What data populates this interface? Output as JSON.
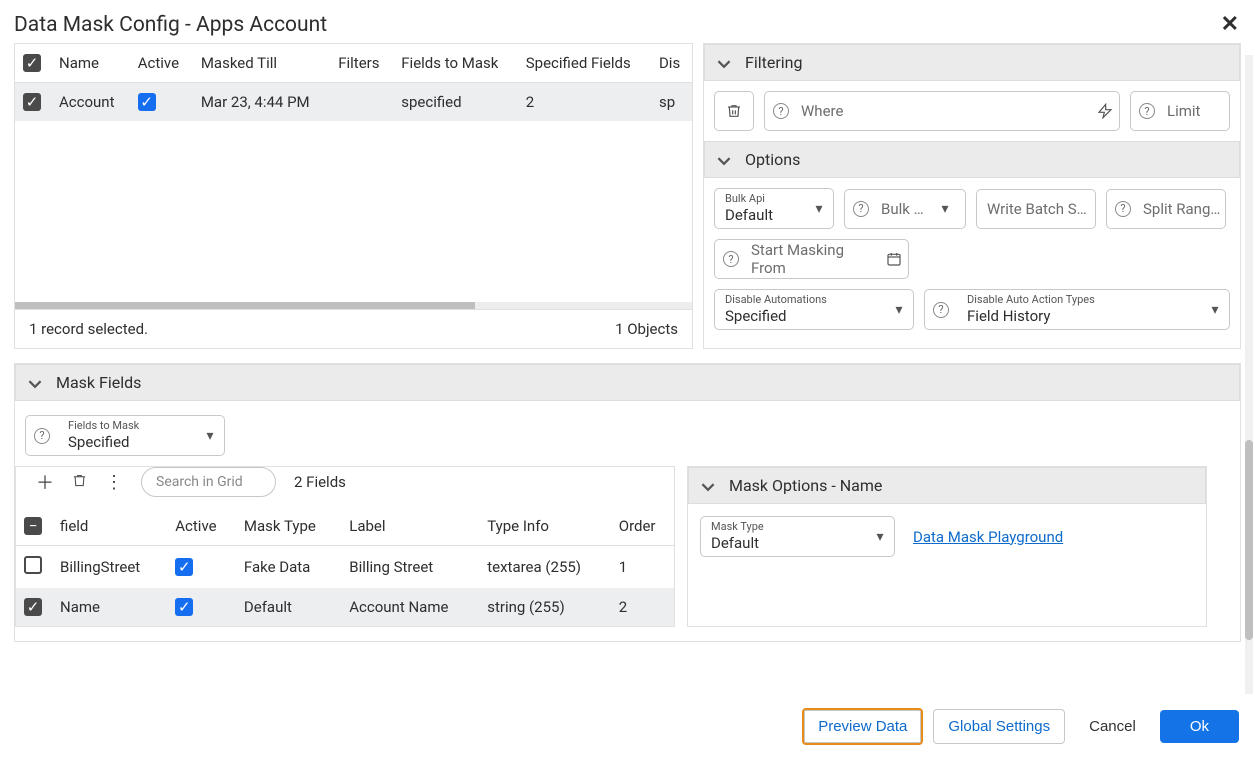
{
  "title": "Data Mask Config - Apps Account",
  "objectsTable": {
    "headers": [
      "Name",
      "Active",
      "Masked Till",
      "Filters",
      "Fields to Mask",
      "Specified Fields",
      "Dis"
    ],
    "rows": [
      {
        "name": "Account",
        "active": true,
        "maskedTill": "Mar 23, 4:44 PM",
        "filters": "",
        "fieldsToMask": "specified",
        "specifiedFields": "2",
        "dis": "sp"
      }
    ],
    "statusLeft": "1 record selected.",
    "statusRight": "1 Objects"
  },
  "filtering": {
    "header": "Filtering",
    "where": "Where",
    "limit": "Limit"
  },
  "options": {
    "header": "Options",
    "bulkApiLabel": "Bulk Api",
    "bulkApiValue": "Default",
    "bulk": "Bulk …",
    "writeBatch": "Write Batch S…",
    "splitRange": "Split Rang…",
    "startMasking": "Start Masking From",
    "disableAutoLabel": "Disable Automations",
    "disableAutoValue": "Specified",
    "disableActionLabel": "Disable Auto Action Types",
    "disableActionValue": "Field History"
  },
  "maskFields": {
    "header": "Mask Fields",
    "selectorLabel": "Fields to Mask",
    "selectorValue": "Specified",
    "searchPlaceholder": "Search in Grid",
    "count": "2 Fields",
    "grid": {
      "headers": [
        "field",
        "Active",
        "Mask Type",
        "Label",
        "Type Info",
        "Order"
      ],
      "rows": [
        {
          "field": "BillingStreet",
          "active": true,
          "maskType": "Fake Data",
          "label": "Billing Street",
          "typeInfo": "textarea (255)",
          "order": "1",
          "checked": false
        },
        {
          "field": "Name",
          "active": true,
          "maskType": "Default",
          "label": "Account Name",
          "typeInfo": "string (255)",
          "order": "2",
          "checked": true
        }
      ]
    }
  },
  "maskOptions": {
    "header": "Mask Options - Name",
    "maskTypeLabel": "Mask Type",
    "maskTypeValue": "Default",
    "playgroundLink": "Data Mask Playground"
  },
  "footer": {
    "preview": "Preview Data",
    "global": "Global Settings",
    "cancel": "Cancel",
    "ok": "Ok"
  }
}
